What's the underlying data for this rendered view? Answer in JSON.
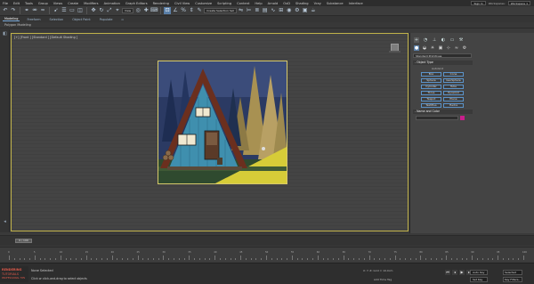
{
  "menubar": {
    "items": [
      "File",
      "Edit",
      "Tools",
      "Group",
      "Views",
      "Create",
      "Modifiers",
      "Animation",
      "Graph Editors",
      "Rendering",
      "Civil View",
      "Customize",
      "Scripting",
      "Content",
      "Help",
      "Arnold",
      "OxD",
      "Shading",
      "Vray",
      "Substance",
      "Interface"
    ],
    "sign_in": "Sign In",
    "workspace_label": "Workspaces:",
    "workspace_value": "Workspace 1"
  },
  "toolbar": {
    "view_dropdown": "View",
    "selection_set": "Create Selection Set",
    "icons": [
      "undo-icon",
      "redo-icon",
      "link-icon",
      "unlink-icon",
      "bind-icon",
      "select-icon",
      "select-by-name-icon",
      "rect-region-icon",
      "window-crossing-icon",
      "move-icon",
      "rotate-icon",
      "scale-icon",
      "select-place-icon"
    ]
  },
  "ribbon": {
    "tabs": [
      "Modeling",
      "Freeform",
      "Selection",
      "Object Paint",
      "Populate"
    ],
    "active_tab": "Modeling",
    "sub_label": "Polygon Modeling"
  },
  "viewport": {
    "label": "[+] [Front ] [Standard ] [Default Shading ]"
  },
  "command_panel": {
    "category_dropdown": "Standard Primitives",
    "object_type_header": "- Object Type",
    "autogrid_label": "AutoGrid",
    "primitives": [
      "Box",
      "Cone",
      "Sphere",
      "GeoSphere",
      "Cylinder",
      "Tube",
      "Torus",
      "Pyramid",
      "Teapot",
      "Plane",
      "TextPlus",
      "Hedra"
    ],
    "name_color_header": "- Name and Color",
    "object_color": "#c81e8c"
  },
  "timeline": {
    "slider_text": "0 / 100",
    "ruler_labels": [
      "0",
      "5",
      "10",
      "15",
      "20",
      "25",
      "30",
      "35",
      "40",
      "45",
      "50",
      "55",
      "60",
      "65",
      "70",
      "75",
      "80",
      "85",
      "90",
      "95",
      "100"
    ]
  },
  "status": {
    "none_selected": "None Selected",
    "hint": "Click or click-and-drag to select objects",
    "coords": "X:  Y:  Z:  Grid = 10.0cm",
    "addtime": "Add Time Tag",
    "key_auto": "Auto Key",
    "key_set": "Set Key",
    "selected_dropdown": "Selected",
    "key_filters": "Key Filters..."
  },
  "logo": {
    "line1": "RENDERING",
    "line2": "TUTORIALS",
    "line3": "PROFESSIONAL TIPS"
  }
}
